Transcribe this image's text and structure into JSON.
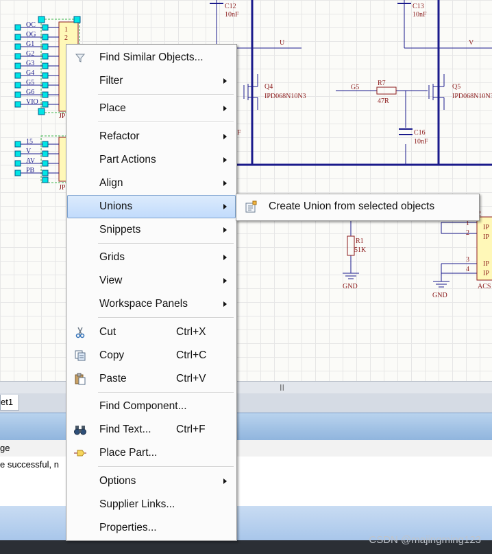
{
  "schematic": {
    "labels_blue": [
      "OC",
      "OG",
      "G1",
      "G2",
      "G3",
      "G4",
      "G5",
      "G6",
      "VIO",
      "15",
      "V",
      "AV",
      "PB"
    ],
    "pins_a": [
      "1",
      "2"
    ],
    "jp_labels": [
      "JP",
      "JP"
    ],
    "c12": {
      "ref": "C12",
      "val": "10nF"
    },
    "c13": {
      "ref": "C13",
      "val": "10nF"
    },
    "c16": {
      "ref": "C16",
      "val": "10nF"
    },
    "q4": {
      "ref": "Q4",
      "val": "IPD068N10N3"
    },
    "q5": {
      "ref": "Q5",
      "val": "IPD068N10N3"
    },
    "r7": {
      "ref": "R7",
      "val": "47R"
    },
    "r1": {
      "ref": "R1",
      "val": "51K"
    },
    "net_u": "U",
    "net_v": "V",
    "net_g5": "G5",
    "cap_frag": "F",
    "gnd1": "GND",
    "gnd2": "GND",
    "ic_ref": "2",
    "ic_pins": [
      "1",
      "2",
      "3",
      "4"
    ],
    "ic_pin_names": [
      "IP",
      "IP",
      "IP",
      "IP"
    ],
    "ic_name": "ACS"
  },
  "panels": {
    "sheet_tab": "et1",
    "msg_header": "ge",
    "msg_row": "e successful, n",
    "scroll_grip": "|||"
  },
  "menu": {
    "items": [
      {
        "label": "Find Similar Objects...",
        "icon": "funnel-icon"
      },
      {
        "label": "Filter"
      },
      {
        "label": "Place"
      },
      {
        "label": "Refactor"
      },
      {
        "label": "Part Actions"
      },
      {
        "label": "Align"
      },
      {
        "label": "Unions"
      },
      {
        "label": "Snippets"
      },
      {
        "label": "Grids"
      },
      {
        "label": "View"
      },
      {
        "label": "Workspace Panels"
      },
      {
        "label": "Cut",
        "shortcut": "Ctrl+X",
        "icon": "scissors-icon"
      },
      {
        "label": "Copy",
        "shortcut": "Ctrl+C",
        "icon": "copy-icon"
      },
      {
        "label": "Paste",
        "shortcut": "Ctrl+V",
        "icon": "paste-icon"
      },
      {
        "label": "Find Component..."
      },
      {
        "label": "Find Text...",
        "shortcut": "Ctrl+F",
        "icon": "binoculars-icon"
      },
      {
        "label": "Place Part...",
        "icon": "place-part-icon"
      },
      {
        "label": "Options"
      },
      {
        "label": "Supplier Links..."
      },
      {
        "label": "Properties..."
      }
    ],
    "submenu": {
      "label": "Create Union from selected objects",
      "icon": "union-icon"
    }
  },
  "watermark": "CSDN @majingming123"
}
